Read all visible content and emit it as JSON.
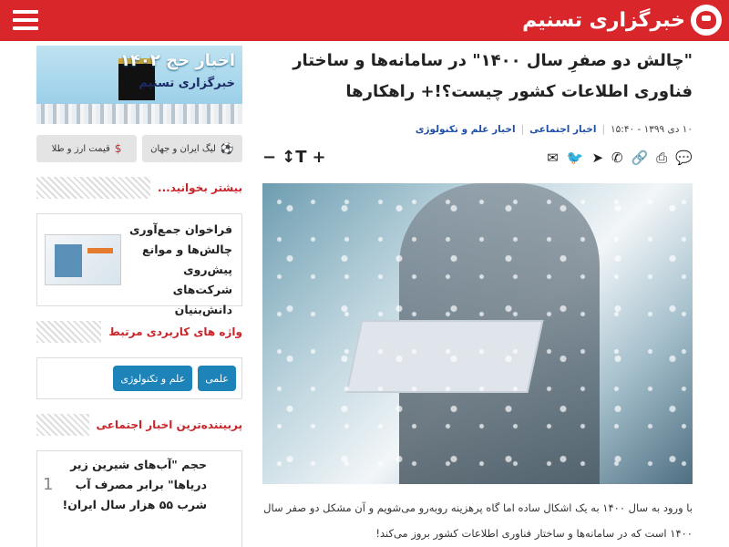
{
  "header": {
    "logo_text": "خبرگزاری تسنیم",
    "brand_color": "#d8262b"
  },
  "sidebar": {
    "banner": {
      "title": "اخبار حج ۱۴۰۲",
      "subtitle": "خبرگزاری تسنیم"
    },
    "quick_links": [
      {
        "label": "قیمت ارز و طلا",
        "icon": "dollar-icon"
      },
      {
        "label": "لیگ ایران و جهان",
        "icon": "soccer-ball-icon"
      }
    ],
    "read_more": {
      "title": "بیشتر بخوانید...",
      "item": "فراخوان جمع‌آوری چالش‌ها و موانع پیش‌روی شرکت‌های دانش‌بنیان"
    },
    "keywords": {
      "title": "واژه های کاربردی مرتبط",
      "tags": [
        "علمی",
        "علم و تکنولوژی"
      ]
    },
    "popular": {
      "title": "پربیننده‌ترین اخبار اجتماعی",
      "items": [
        {
          "rank": "1",
          "text": "حجم \"آب‌های شیرین زیر دریاها\" برابر مصرف آب شرب ۵۵ هزار سال ایران!"
        }
      ]
    }
  },
  "article": {
    "headline": "\"چالش دو صفرِ سال ۱۴۰۰\" در سامانه‌ها و ساختار فناوری اطلاعات کشور چیست؟!+ راهکارها",
    "date": "۱۰ دی ۱۳۹۹ - ۱۵:۴۰",
    "categories": [
      "اخبار اجتماعی",
      "اخبار علم و تکنولوژی"
    ],
    "body": "با ورود به سال ۱۴۰۰ به یک اشکال ساده اما گاه پرهزینه روبه‌رو می‌شویم و آن مشکل دو صفر سال ۱۴۰۰ است که در سامانه‌ها و ساختار فناوری اطلاعات کشور بروز می‌کند!"
  }
}
